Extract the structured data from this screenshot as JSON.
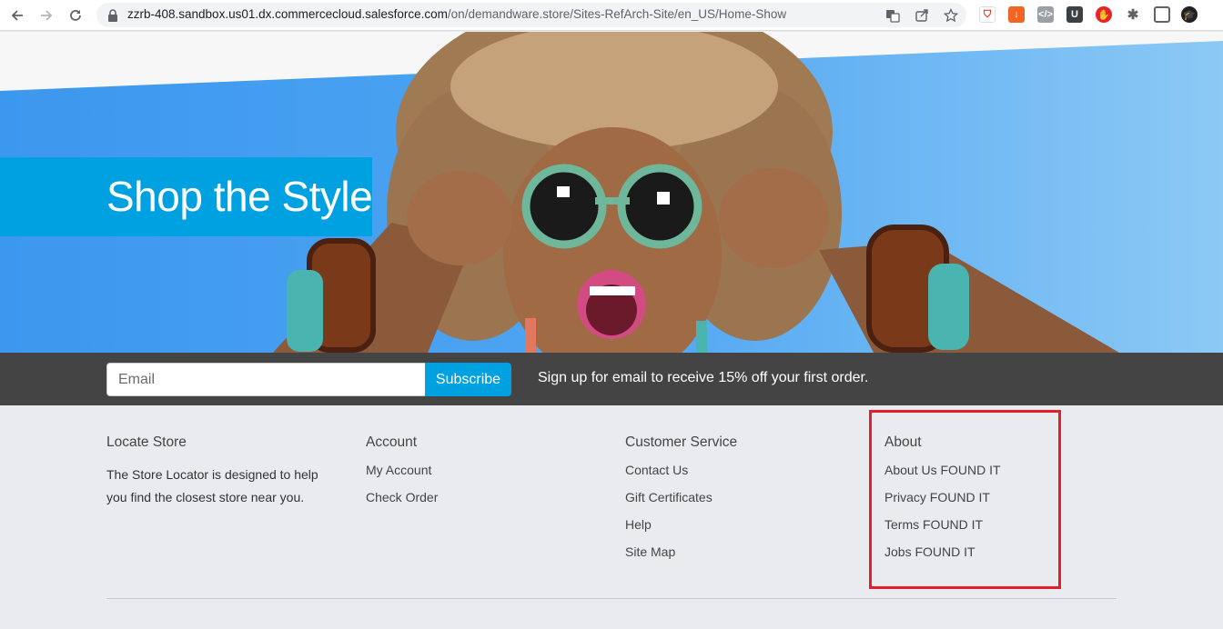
{
  "browser": {
    "url_host": "zzrb-408.sandbox.us01.dx.commercecloud.salesforce.com",
    "url_path": "/on/demandware.store/Sites-RefArch-Site/en_US/Home-Show"
  },
  "hero": {
    "headline": "Shop the Style"
  },
  "signup": {
    "email_placeholder": "Email",
    "subscribe_label": "Subscribe",
    "message": "Sign up for email to receive 15% off your first order."
  },
  "footer": {
    "locate_store": {
      "heading": "Locate Store",
      "text": "The Store Locator is designed to help you find the closest store near you."
    },
    "account": {
      "heading": "Account",
      "links": [
        "My Account",
        "Check Order"
      ]
    },
    "customer_service": {
      "heading": "Customer Service",
      "links": [
        "Contact Us",
        "Gift Certificates",
        "Help",
        "Site Map"
      ]
    },
    "about": {
      "heading": "About",
      "links": [
        "About Us FOUND IT",
        "Privacy FOUND IT",
        "Terms FOUND IT",
        "Jobs FOUND IT"
      ]
    }
  },
  "colors": {
    "brand_blue": "#00a1e0",
    "signup_bar": "#444444",
    "footer_bg": "#e9ebee",
    "highlight_red": "#e0202a"
  }
}
